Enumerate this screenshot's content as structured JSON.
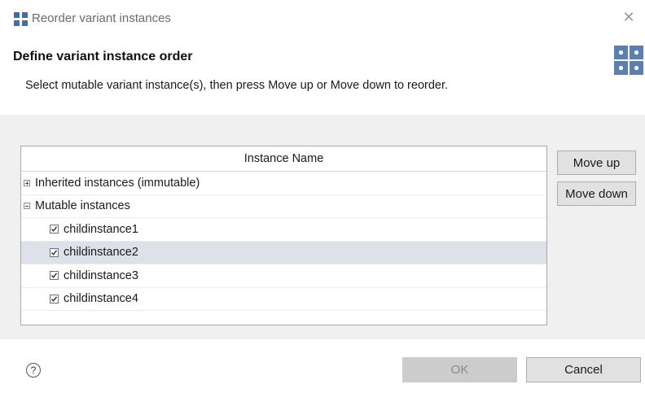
{
  "window": {
    "title": "Reorder variant instances",
    "close_glyph": "✕",
    "icon": "grid-icon"
  },
  "header": {
    "title": "Define variant instance order",
    "description": "Select mutable variant instance(s), then press Move up or Move down to reorder.",
    "icon": "wizard-grid-icon"
  },
  "table": {
    "column_header": "Instance Name",
    "rows": [
      {
        "label": "Inherited instances (immutable)",
        "kind": "group",
        "expanded": false,
        "selected": false
      },
      {
        "label": "Mutable instances",
        "kind": "group",
        "expanded": true,
        "selected": false
      },
      {
        "label": "childinstance1",
        "kind": "item",
        "checked": true,
        "selected": false
      },
      {
        "label": "childinstance2",
        "kind": "item",
        "checked": true,
        "selected": true
      },
      {
        "label": "childinstance3",
        "kind": "item",
        "checked": true,
        "selected": false
      },
      {
        "label": "childinstance4",
        "kind": "item",
        "checked": true,
        "selected": false
      }
    ]
  },
  "side_buttons": {
    "move_up": "Move up",
    "move_down": "Move down"
  },
  "footer": {
    "help_glyph": "?",
    "ok": "OK",
    "ok_enabled": false,
    "cancel": "Cancel"
  },
  "colors": {
    "selection": "#dde1ea",
    "icon_blue": "#5b7fb0",
    "content_bg": "#f0f0f0"
  }
}
